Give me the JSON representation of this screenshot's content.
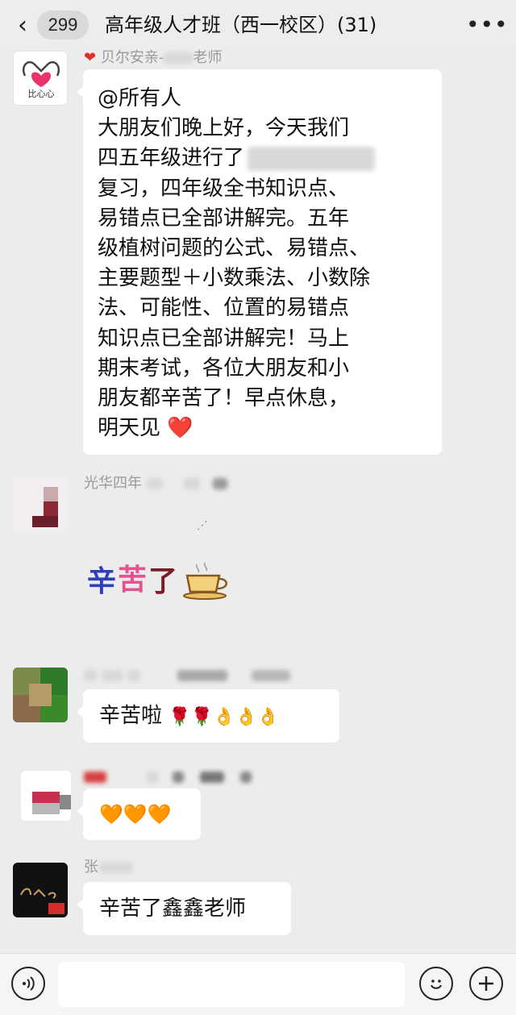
{
  "header": {
    "back_icon": "chevron-left-icon",
    "unread_count": "299",
    "title": "高年级人才班（西一校区）(31)",
    "more_icon": "more-dots-icon"
  },
  "messages": [
    {
      "sender": "贝尔安亲-",
      "sender_suffix": "老师",
      "avatar_label": "比心心",
      "lines": [
        "@所有人",
        "大朋友们晚上好，今天我们",
        "四五年级进行了",
        "复习，四年级全书知识点、",
        "易错点已全部讲解完。五年",
        "级植树问题的公式、易错点、",
        "主要题型＋小数乘法、小数除",
        "法、可能性、位置的易错点",
        "知识点已全部讲解完！马上",
        "期末考试，各位大朋友和小",
        "朋友都辛苦了！早点休息，",
        "明天见"
      ],
      "trailing_emoji": "❤️"
    },
    {
      "sender": "光华四年",
      "sticker_text": [
        "辛",
        "苦",
        "了"
      ],
      "sticker_icon": "coffee-cup-icon"
    },
    {
      "text": "辛苦啦",
      "emoji": "🌹🌹👌👌👌"
    },
    {
      "emoji": "🧡🧡🧡"
    },
    {
      "sender": "张",
      "text": "辛苦了鑫鑫老师"
    }
  ],
  "input_bar": {
    "voice_icon": "voice-icon",
    "emoji_icon": "emoji-icon",
    "plus_icon": "plus-icon",
    "input_placeholder": ""
  },
  "colors": {
    "background": "#ececec",
    "bubble": "#ffffff",
    "heart": "#e0322d",
    "sender_text": "#9a9a9a"
  }
}
